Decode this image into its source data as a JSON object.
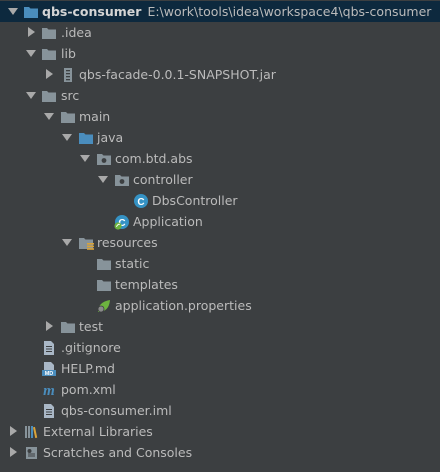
{
  "tree": {
    "root": {
      "name": "qbs-consumer",
      "path": "E:\\work\\tools\\idea\\workspace4\\qbs-consumer"
    },
    "idea": ".idea",
    "lib": "lib",
    "jar": "qbs-facade-0.0.1-SNAPSHOT.jar",
    "src": "src",
    "main": "main",
    "java": "java",
    "package": "com.btd.abs",
    "controller": "controller",
    "dbs_controller": "DbsController",
    "application": "Application",
    "resources": "resources",
    "static": "static",
    "templates": "templates",
    "app_properties": "application.properties",
    "test": "test",
    "gitignore": ".gitignore",
    "help": "HELP.md",
    "pom": "pom.xml",
    "iml": "qbs-consumer.iml",
    "external_libraries": "External Libraries",
    "scratches": "Scratches and Consoles"
  },
  "colors": {
    "background": "#3c3f41",
    "selection": "#0d293e",
    "folder": "#87939a",
    "source_folder": "#4a8dbd",
    "class_icon": "#3592c4",
    "spring": "#6db33f"
  }
}
